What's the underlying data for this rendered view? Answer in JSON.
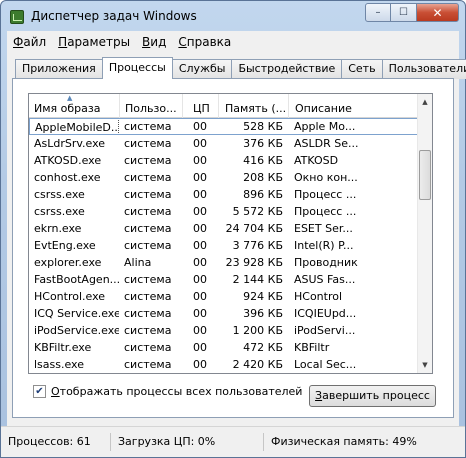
{
  "window": {
    "title": "Диспетчер задач Windows",
    "min_glyph": "–",
    "max_glyph": "☐",
    "close_glyph": "✕"
  },
  "menu": [
    {
      "first": "Ф",
      "rest": "айл"
    },
    {
      "first": "П",
      "rest": "араметры"
    },
    {
      "first": "В",
      "rest": "ид"
    },
    {
      "first": "С",
      "rest": "правка"
    }
  ],
  "tabs": [
    "Приложения",
    "Процессы",
    "Службы",
    "Быстродействие",
    "Сеть",
    "Пользователи"
  ],
  "active_tab": "Процессы",
  "columns": [
    "Имя образа",
    "Пользо...",
    "ЦП",
    "Память (...",
    "Описание"
  ],
  "sort_indicator": "▲",
  "processes": [
    {
      "name": "AppleMobileD...",
      "user": "система",
      "cpu": "00",
      "mem": "528 КБ",
      "desc": "Apple Mo..."
    },
    {
      "name": "AsLdrSrv.exe",
      "user": "система",
      "cpu": "00",
      "mem": "376 КБ",
      "desc": "ASLDR Se..."
    },
    {
      "name": "ATKOSD.exe",
      "user": "система",
      "cpu": "00",
      "mem": "416 КБ",
      "desc": "ATKOSD"
    },
    {
      "name": "conhost.exe",
      "user": "система",
      "cpu": "00",
      "mem": "208 КБ",
      "desc": "Окно кон..."
    },
    {
      "name": "csrss.exe",
      "user": "система",
      "cpu": "00",
      "mem": "896 КБ",
      "desc": "Процесс ..."
    },
    {
      "name": "csrss.exe",
      "user": "система",
      "cpu": "00",
      "mem": "5 572 КБ",
      "desc": "Процесс ..."
    },
    {
      "name": "ekrn.exe",
      "user": "система",
      "cpu": "00",
      "mem": "24 704 КБ",
      "desc": "ESET Ser..."
    },
    {
      "name": "EvtEng.exe",
      "user": "система",
      "cpu": "00",
      "mem": "3 776 КБ",
      "desc": "Intel(R) P..."
    },
    {
      "name": "explorer.exe",
      "user": "Alina",
      "cpu": "00",
      "mem": "23 928 КБ",
      "desc": "Проводник"
    },
    {
      "name": "FastBootAgen...",
      "user": "система",
      "cpu": "00",
      "mem": "2 144 КБ",
      "desc": "ASUS Fas..."
    },
    {
      "name": "HControl.exe",
      "user": "система",
      "cpu": "00",
      "mem": "924 КБ",
      "desc": "HControl"
    },
    {
      "name": "ICQ Service.exe",
      "user": "система",
      "cpu": "00",
      "mem": "396 КБ",
      "desc": "ICQIEUpd..."
    },
    {
      "name": "iPodService.exe",
      "user": "система",
      "cpu": "00",
      "mem": "1 200 КБ",
      "desc": "iPodServi..."
    },
    {
      "name": "KBFiltr.exe",
      "user": "система",
      "cpu": "00",
      "mem": "472 КБ",
      "desc": "KBFiltr"
    },
    {
      "name": "lsass.exe",
      "user": "система",
      "cpu": "00",
      "mem": "2 420 КБ",
      "desc": "Local Sec..."
    }
  ],
  "selected_process": "AppleMobileD...",
  "show_all_users": {
    "label": "Отображать процессы всех пользователей",
    "underline_char": "О",
    "checked": true,
    "check_glyph": "✔"
  },
  "end_process_button": "Завершить процесс",
  "end_process_underline": "З",
  "scroll_glyphs": {
    "up": "▲",
    "down": "▼"
  },
  "status": {
    "processes": "Процессов: 61",
    "cpu": "Загрузка ЦП: 0%",
    "memory": "Физическая память: 49%"
  }
}
